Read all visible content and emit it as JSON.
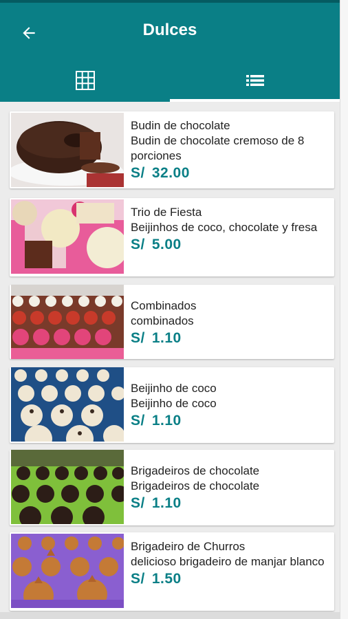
{
  "header": {
    "title": "Dulces",
    "back_icon": "arrow-left-icon",
    "tabs": [
      {
        "icon": "grid-view-icon",
        "selected": false
      },
      {
        "icon": "list-view-icon",
        "selected": true
      }
    ],
    "colors": {
      "bar": "#0a7f86",
      "text": "#ffffff"
    }
  },
  "products": [
    {
      "name": "Budin de chocolate",
      "description": "Budin de chocolate cremoso de 8 porciones",
      "currency": "S/",
      "price": "32.00",
      "image": "chocolate-bundt-cake"
    },
    {
      "name": "Trio de Fiesta",
      "description": "Beijinhos de coco, chocolate y fresa",
      "currency": "S/",
      "price": "5.00",
      "image": "party-sweets-cups"
    },
    {
      "name": "Combinados",
      "description": "combinados",
      "currency": "S/",
      "price": "1.10",
      "image": "assorted-truffles"
    },
    {
      "name": "Beijinho de coco",
      "description": "Beijinho de coco",
      "currency": "S/",
      "price": "1.10",
      "image": "coconut-truffles"
    },
    {
      "name": "Brigadeiros de chocolate",
      "description": "Brigadeiros de chocolate",
      "currency": "S/",
      "price": "1.10",
      "image": "chocolate-brigadeiros"
    },
    {
      "name": "Brigadeiro de Churros",
      "description": "delicioso brigadeiro de manjar blanco",
      "currency": "S/",
      "price": "1.50",
      "image": "churros-brigadeiros"
    }
  ]
}
